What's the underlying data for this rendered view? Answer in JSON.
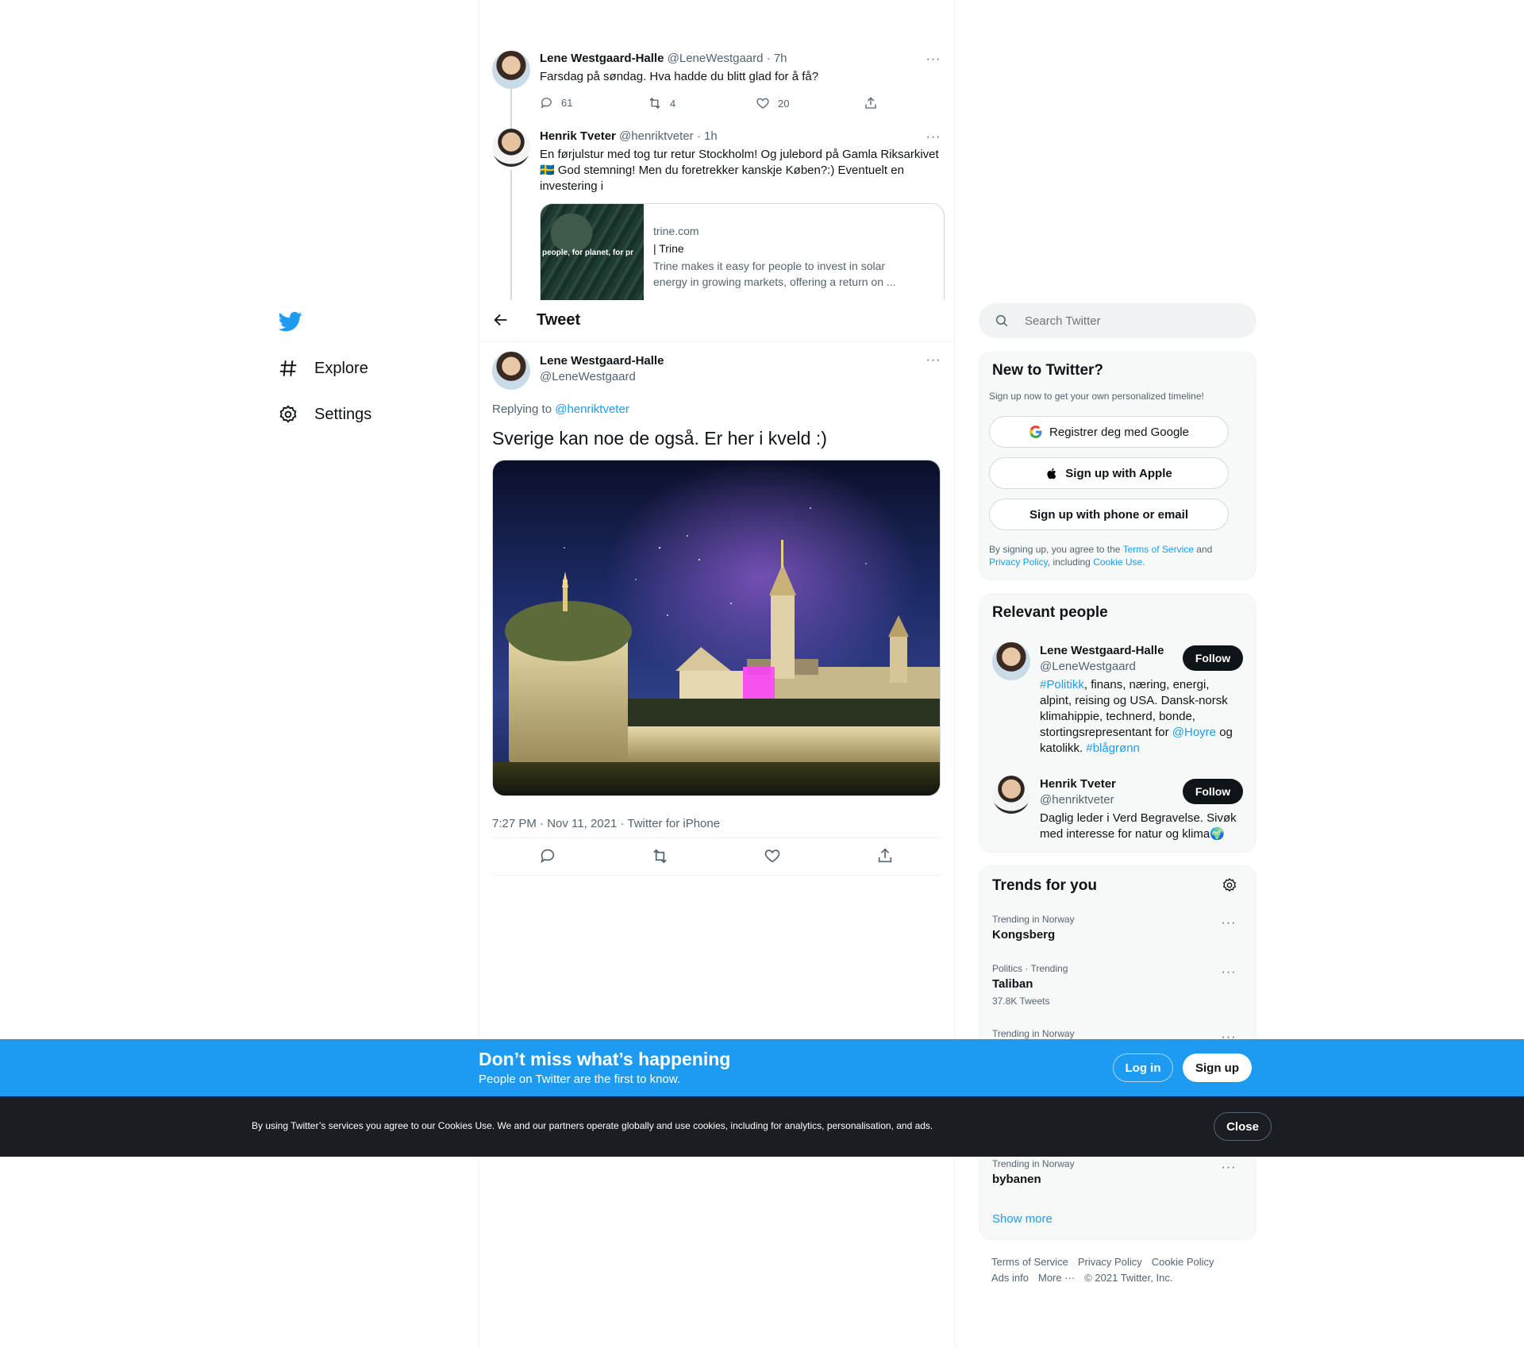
{
  "nav": {
    "logo": "twitter-bird",
    "items": [
      {
        "label": "Explore",
        "icon": "hashtag-icon"
      },
      {
        "label": "Settings",
        "icon": "gear-icon"
      }
    ]
  },
  "thread": [
    {
      "author": "Lene Westgaard-Halle",
      "handle": "@LeneWestgaard",
      "time": "· 7h",
      "text": "Farsdag på søndag. Hva hadde du blitt glad for å få?",
      "replies": "61",
      "retweets": "4",
      "likes": "20"
    },
    {
      "author": "Henrik Tveter",
      "handle": "@henriktveter",
      "time": "· 1h",
      "text_line1": "En førjulstur med tog tur retur Stockholm! Og julebord på Gamla Riksarkivet",
      "text_line2": "🇸🇪 God stemning! Men du foretrekker kanskje Køben?:)  Eventuelt en",
      "text_line3": "investering i",
      "card": {
        "image_text": "people, for planet, for pr",
        "domain": "trine.com",
        "title": "| Trine",
        "desc_line1": "Trine makes it easy for people to invest in solar",
        "desc_line2": "energy in growing markets, offering a return on ..."
      }
    }
  ],
  "header": {
    "title": "Tweet"
  },
  "main_tweet": {
    "author": "Lene Westgaard-Halle",
    "handle": "@LeneWestgaard",
    "replying_prefix": "Replying to",
    "replying_to": "@henriktveter",
    "text": "Sverige kan noe de også. Er her i kveld :)",
    "meta": "7:27 PM · Nov 11, 2021 · Twitter for iPhone"
  },
  "search": {
    "placeholder": "Search Twitter"
  },
  "new_to_twitter": {
    "title": "New to Twitter?",
    "subtitle": "Sign up now to get your own personalized timeline!",
    "google": "Registrer deg med Google",
    "apple": "Sign up with Apple",
    "phone": "Sign up with phone or email",
    "legal_prefix": "By signing up, you agree to the",
    "terms": "Terms of Service",
    "and": "and",
    "privacy": "Privacy Policy",
    "including": ", including",
    "cookie": "Cookie Use."
  },
  "relevant_people": {
    "title": "Relevant people",
    "people": [
      {
        "name": "Lene Westgaard-Halle",
        "handle": "@LeneWestgaard",
        "follow": "Follow",
        "bio_tag1": "#Politikk",
        "bio_part1": ", finans, næring, energi,",
        "bio_line2": "alpint, reising og USA. Dansk-norsk",
        "bio_line3": "klimahippie, technerd, bonde,",
        "bio_line4_prefix": "stortingsrepresentant for",
        "bio_mention": "@Hoyre",
        "bio_line4_suffix": "og",
        "bio_line5_prefix": "katolikk.",
        "bio_tag2": "#blågrønn"
      },
      {
        "name": "Henrik Tveter",
        "handle": "@henriktveter",
        "follow": "Follow",
        "bio_line1": "Daglig leder i Verd Begravelse. Sivøk",
        "bio_line2": "med interesse for natur og klima🌍"
      }
    ]
  },
  "trends": {
    "title": "Trends for you",
    "items": [
      {
        "context": "Trending in Norway",
        "name": "Kongsberg"
      },
      {
        "context": "Politics · Trending",
        "name": "Taliban",
        "count": "37.8K Tweets"
      },
      {
        "context": "Trending in Norway",
        "name": ""
      },
      {
        "context": "Trending in Norway",
        "name": "bybanen"
      }
    ],
    "show_more": "Show more"
  },
  "footer": {
    "links": [
      "Terms of Service",
      "Privacy Policy",
      "Cookie Policy",
      "Ads info",
      "More ···"
    ],
    "copyright": "© 2021 Twitter, Inc."
  },
  "signup_bar": {
    "title": "Don’t miss what’s happening",
    "subtitle": "People on Twitter are the first to know.",
    "login": "Log in",
    "signup": "Sign up"
  },
  "cookie_bar": {
    "text": "By using Twitter’s services you agree to our Cookies Use. We and our partners operate globally and use cookies, including for analytics, personalisation, and ads.",
    "close": "Close"
  },
  "colors": {
    "accent": "#1d9bf0",
    "text": "#0f1419",
    "muted": "#536471",
    "cookie_bg": "#1a1e22"
  }
}
